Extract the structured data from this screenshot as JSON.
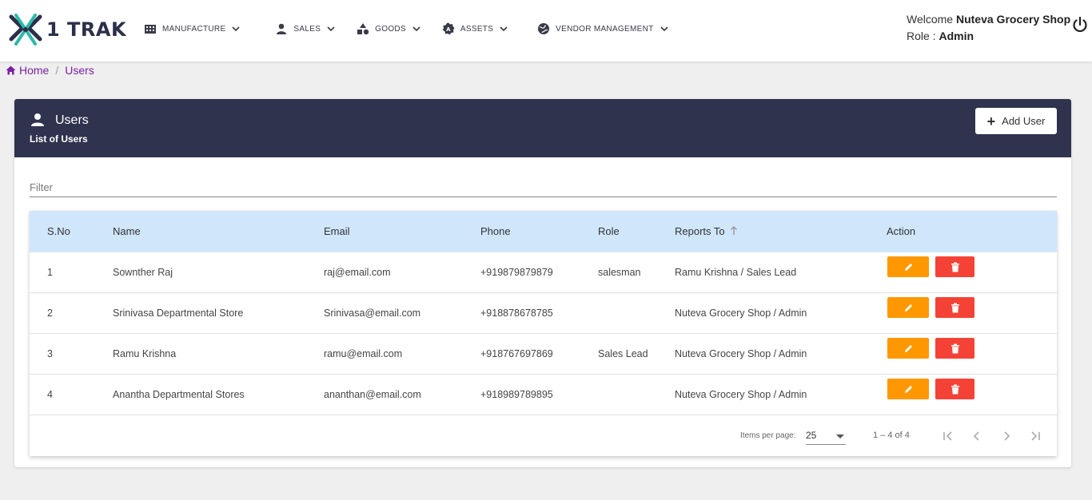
{
  "brand": {
    "logo_text": "1 TRAK"
  },
  "nav": [
    {
      "label": "MANUFACTURE",
      "icon": "building-icon"
    },
    {
      "label": "SALES",
      "icon": "person-icon"
    },
    {
      "label": "GOODS",
      "icon": "shapes-icon"
    },
    {
      "label": "ASSETS",
      "icon": "gear-badge-icon"
    },
    {
      "label": "VENDOR MANAGEMENT",
      "icon": "globe-icon"
    }
  ],
  "user": {
    "welcome_prefix": "Welcome",
    "name": "Nuteva Grocery Shop",
    "role_prefix": "Role :",
    "role": "Admin"
  },
  "breadcrumb": {
    "home": "Home",
    "separator": "/",
    "current": "Users"
  },
  "card": {
    "title": "Users",
    "subtitle": "List of Users",
    "add_button": "Add User",
    "filter_placeholder": "Filter"
  },
  "table": {
    "headers": [
      "S.No",
      "Name",
      "Email",
      "Phone",
      "Role",
      "Reports To",
      "Action"
    ],
    "rows": [
      {
        "sno": "1",
        "name": "Sownther Raj",
        "email": "raj@email.com",
        "phone": "+919879879879",
        "role": "salesman",
        "reports_to": "Ramu Krishna / Sales Lead"
      },
      {
        "sno": "2",
        "name": "Srinivasa Departmental Store",
        "email": "Srinivasa@email.com",
        "phone": "+918878678785",
        "role": "",
        "reports_to": "Nuteva Grocery Shop / Admin"
      },
      {
        "sno": "3",
        "name": "Ramu Krishna",
        "email": "ramu@email.com",
        "phone": "+918767697869",
        "role": "Sales Lead",
        "reports_to": "Nuteva Grocery Shop / Admin"
      },
      {
        "sno": "4",
        "name": "Anantha Departmental Stores",
        "email": "ananthan@email.com",
        "phone": "+918989789895",
        "role": "",
        "reports_to": "Nuteva Grocery Shop / Admin"
      }
    ]
  },
  "paginator": {
    "items_label": "Items per page:",
    "page_size": "25",
    "range": "1 – 4 of 4"
  },
  "colors": {
    "header_bg": "#30334e",
    "table_head_bg": "#cfe6fb",
    "edit": "#ff9800",
    "delete": "#f44336",
    "breadcrumb": "#7b1fa2"
  }
}
